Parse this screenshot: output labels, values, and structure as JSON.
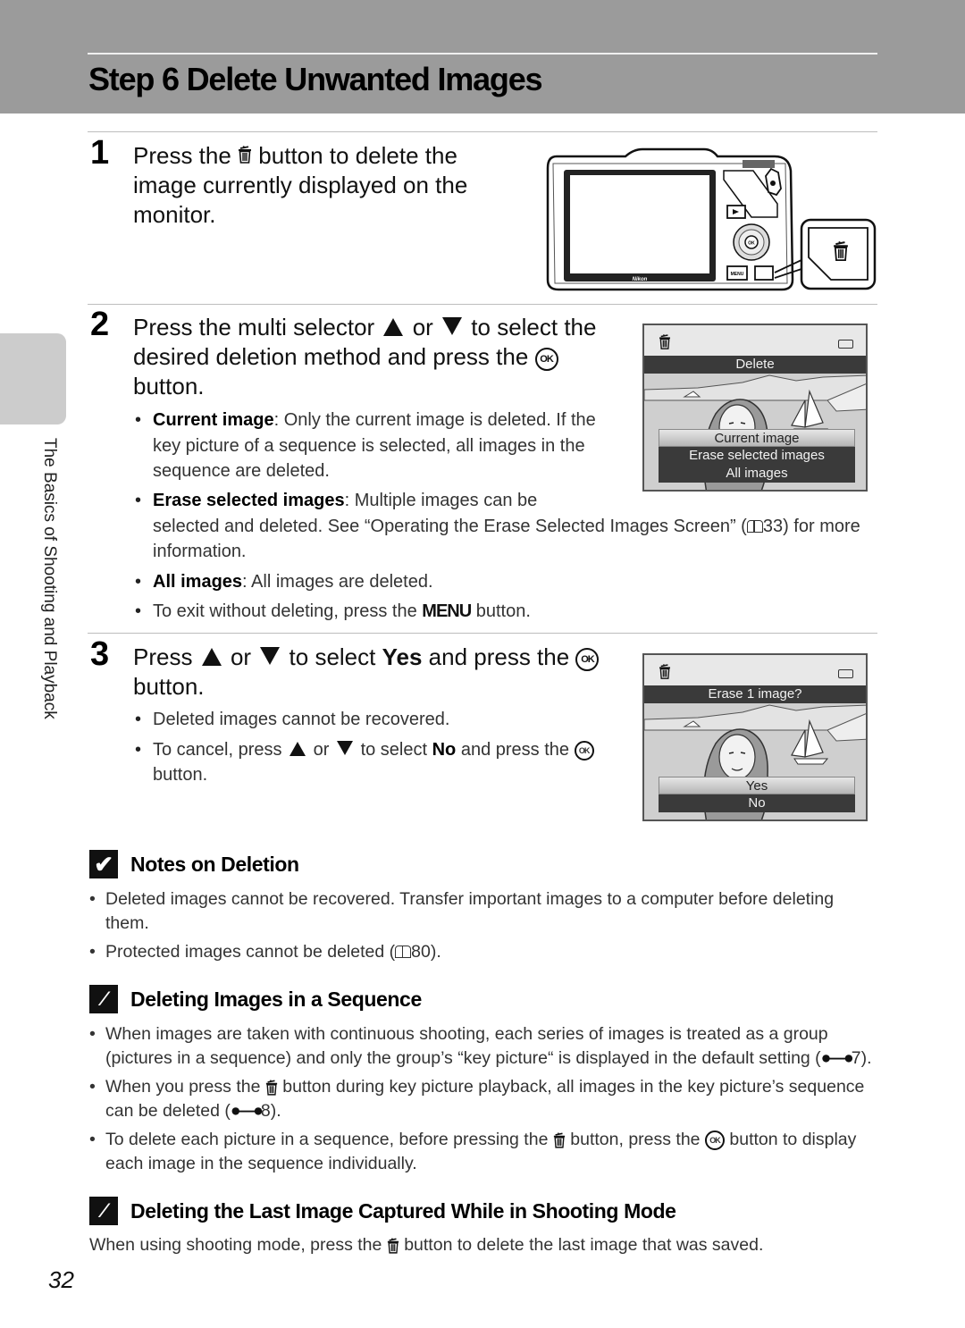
{
  "header": {
    "title": "Step 6 Delete Unwanted Images"
  },
  "side_tab": {
    "label": "The Basics of Shooting and Playback"
  },
  "steps": [
    {
      "number": "1",
      "text_before_icon": "Press the",
      "icon": "trash-icon",
      "text_after_icon": "button to delete the image currently displayed on the monitor."
    },
    {
      "number": "2",
      "text_part1": "Press the multi selector",
      "or": "or",
      "text_part2": "to select the desired deletion method and press the",
      "text_part3": "button.",
      "bullets": [
        {
          "bold": "Current image",
          "text": ": Only the current image is deleted. If the key picture of a sequence is selected, all images in the sequence are deleted."
        },
        {
          "bold": "Erase selected images",
          "text_a": ": Multiple images can be",
          "text_b": "selected and deleted. See “Operating the Erase Selected Images Screen” (",
          "ref": "33",
          "text_c": ") for more information."
        },
        {
          "bold": "All images",
          "text": ": All images are deleted."
        },
        {
          "text_a": "To exit without deleting, press the",
          "menu": "MENU",
          "text_b": "button."
        }
      ]
    },
    {
      "number": "3",
      "text_part1": "Press",
      "or": "or",
      "text_part2": "to select",
      "bold": "Yes",
      "text_part3": "and press the",
      "text_part4": "button.",
      "bullets": [
        {
          "text": "Deleted images cannot be recovered."
        },
        {
          "text_a": "To cancel, press",
          "or": "or",
          "text_b": "to select",
          "bold": "No",
          "text_c": "and press the",
          "text_d": "button."
        }
      ]
    }
  ],
  "ok_label": "OK",
  "camera": {
    "brand": "Nikon",
    "menu_button": "MENU"
  },
  "screen_delete": {
    "title": "Delete",
    "options": [
      "Current image",
      "Erase selected images",
      "All images"
    ],
    "selected_index": 0
  },
  "screen_confirm": {
    "title": "Erase 1 image?",
    "options": [
      "Yes",
      "No"
    ],
    "selected_index": 0
  },
  "notes": [
    {
      "icon": "check-note-icon",
      "title": "Notes on Deletion",
      "items": [
        {
          "text": "Deleted images cannot be recovered. Transfer important images to a computer before deleting them."
        },
        {
          "text_a": "Protected images cannot be deleted (",
          "ref": "80",
          "text_b": ")."
        }
      ]
    },
    {
      "icon": "pencil-note-icon",
      "title": "Deleting Images in a Sequence",
      "items": [
        {
          "text_a": "When images are taken with continuous shooting, each series of images is treated as a group (pictures in a sequence) and only the group’s “key picture“ is displayed in the default setting (",
          "ref": "7",
          "text_b": ")."
        },
        {
          "text_a": "When you press the",
          "text_b": "button during key picture playback, all images in the key picture’s sequence can be deleted (",
          "ref": "8",
          "text_c": ")."
        },
        {
          "text_a": "To delete each picture in a sequence, before pressing the",
          "text_b": "button, press the",
          "text_c": "button to display each image in the sequence individually."
        }
      ]
    },
    {
      "icon": "pencil-note-icon",
      "title": "Deleting the Last Image Captured While in Shooting Mode",
      "text_a": "When using shooting mode, press the",
      "text_b": "button to delete the last image that was saved."
    }
  ],
  "page_number": "32"
}
